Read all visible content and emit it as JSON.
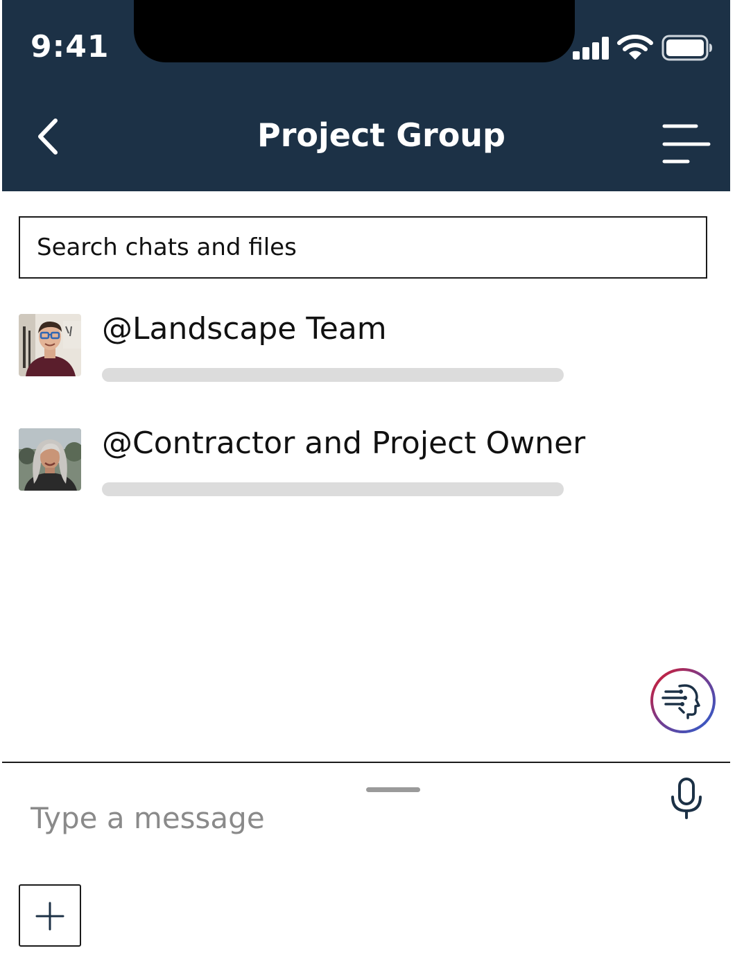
{
  "status_bar": {
    "time": "9:41",
    "signal_icon": "cellular-signal-icon",
    "wifi_icon": "wifi-icon",
    "battery_icon": "battery-icon"
  },
  "header": {
    "title": "Project Group",
    "back_icon": "chevron-left-icon",
    "menu_icon": "menu-icon",
    "background_color": "#1c3146"
  },
  "search": {
    "placeholder": "Search chats and files"
  },
  "chats": [
    {
      "name": "@Landscape Team",
      "avatar": "avatar-photo-man-glasses"
    },
    {
      "name": "@Contractor and Project Owner",
      "avatar": "avatar-photo-woman-gray-hair"
    }
  ],
  "assistant_button": {
    "icon": "ai-head-icon"
  },
  "composer": {
    "placeholder": "Type a message",
    "mic_icon": "microphone-icon",
    "add_icon": "plus-icon"
  }
}
